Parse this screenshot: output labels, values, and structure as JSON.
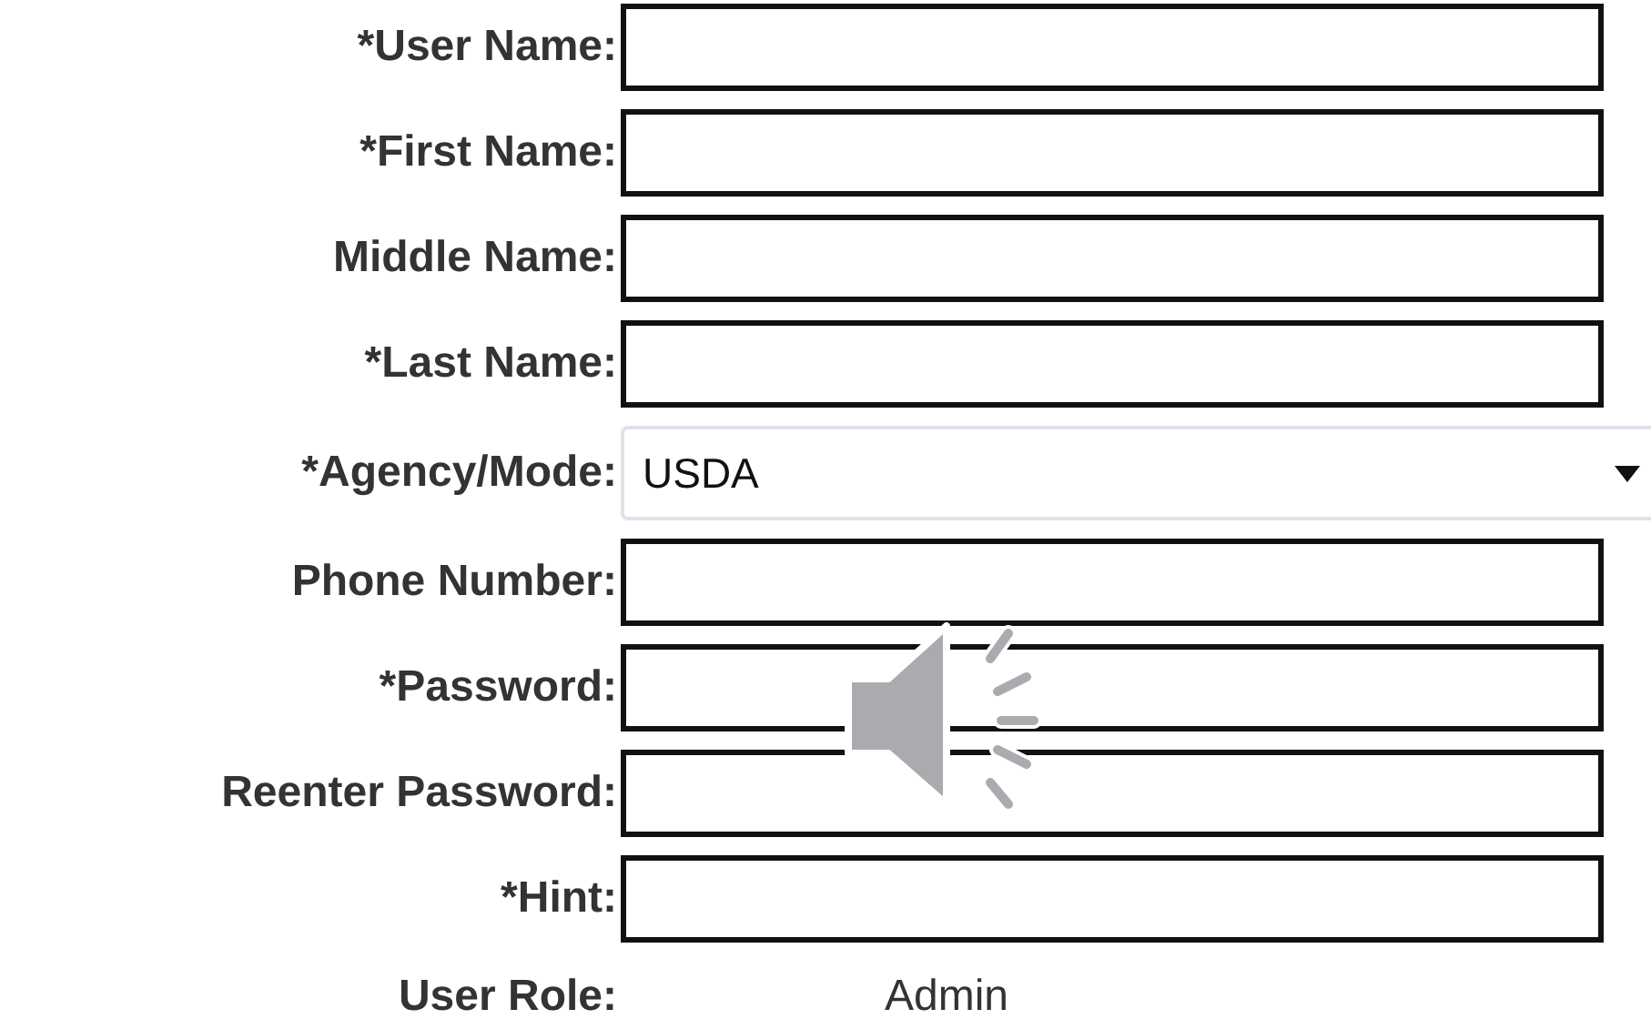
{
  "fields": [
    {
      "label": "*User Name:",
      "kind": "text"
    },
    {
      "label": "*First Name:",
      "kind": "text"
    },
    {
      "label": "Middle Name:",
      "kind": "text"
    },
    {
      "label": "*Last Name:",
      "kind": "text"
    },
    {
      "label": "*Agency/Mode:",
      "kind": "select",
      "value": "USDA"
    },
    {
      "label": "Phone Number:",
      "kind": "text"
    },
    {
      "label": "*Password:",
      "kind": "text"
    },
    {
      "label": "Reenter Password:",
      "kind": "text"
    },
    {
      "label": "*Hint:",
      "kind": "text"
    },
    {
      "label": "User Role:",
      "kind": "static",
      "value": "Admin"
    }
  ]
}
